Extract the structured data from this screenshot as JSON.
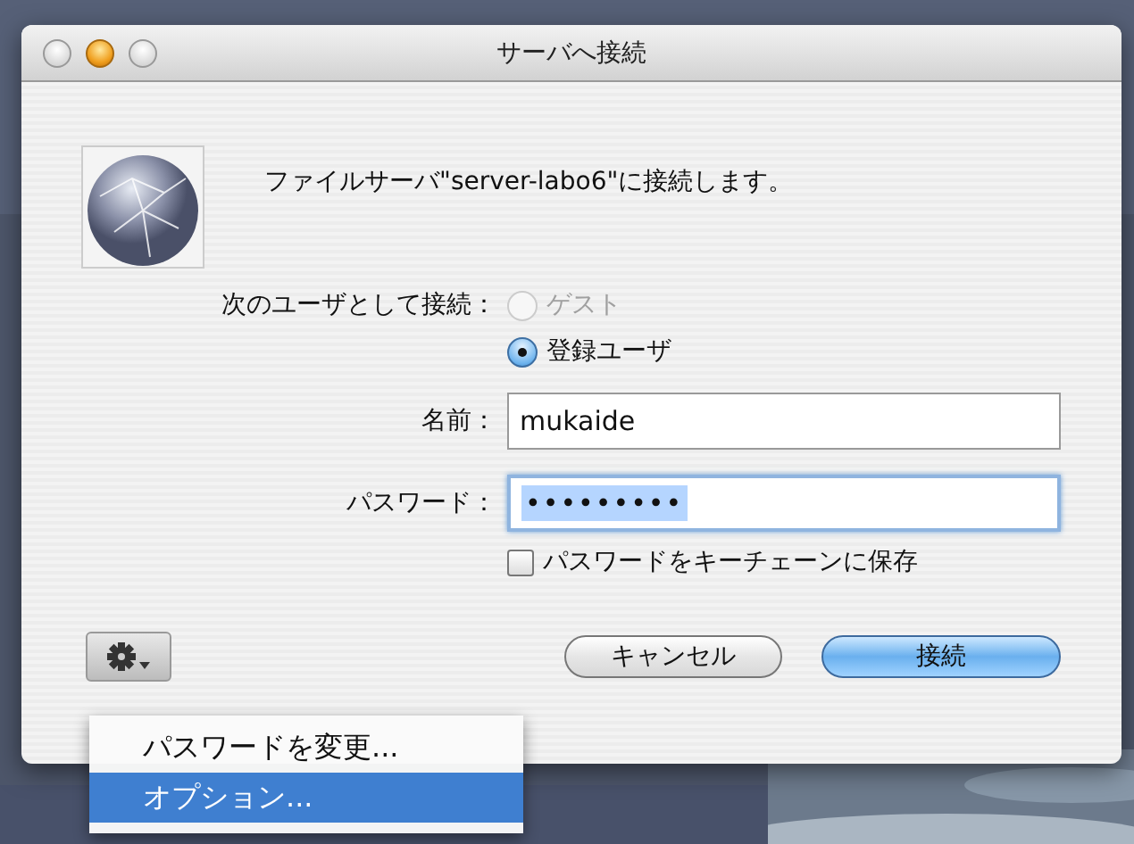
{
  "window": {
    "title": "サーバへ接続"
  },
  "message": "ファイルサーバ\"server-labo6\"に接続します。",
  "connect_as": {
    "label": "次のユーザとして接続：",
    "options": [
      {
        "label": "ゲスト",
        "selected": false,
        "disabled": true
      },
      {
        "label": "登録ユーザ",
        "selected": true,
        "disabled": false
      }
    ]
  },
  "fields": [
    {
      "label": "名前：",
      "value": "mukaide",
      "focused": false
    },
    {
      "label": "パスワード：",
      "value": "•••••••••",
      "focused": true
    }
  ],
  "keychain": {
    "label": "パスワードをキーチェーンに保存",
    "checked": false
  },
  "buttons": [
    {
      "label": "キャンセル",
      "default": false
    },
    {
      "label": "接続",
      "default": true
    }
  ],
  "action_menu": {
    "items": [
      {
        "label": "パスワードを変更...",
        "selected": false
      },
      {
        "label": "オプション...",
        "selected": true
      }
    ]
  }
}
